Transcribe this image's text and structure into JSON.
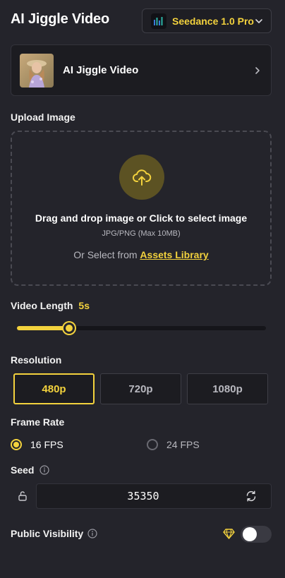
{
  "header": {
    "title": "AI Jiggle Video",
    "model": "Seedance 1.0 Pro"
  },
  "template": {
    "label": "AI Jiggle Video"
  },
  "upload": {
    "section_label": "Upload Image",
    "main_text": "Drag and drop image or Click to select image",
    "formats": "JPG/PNG (Max 10MB)",
    "or_text": "Or Select from",
    "assets_link": "Assets Library"
  },
  "video_length": {
    "label": "Video Length",
    "value": "5s",
    "fraction": 0.21
  },
  "resolution": {
    "label": "Resolution",
    "options": [
      "480p",
      "720p",
      "1080p"
    ],
    "selected": "480p"
  },
  "frame_rate": {
    "label": "Frame Rate",
    "options": [
      "16 FPS",
      "24 FPS"
    ],
    "selected": "16 FPS"
  },
  "seed": {
    "label": "Seed",
    "value": "35350"
  },
  "visibility": {
    "label": "Public Visibility",
    "enabled": false
  },
  "colors": {
    "accent": "#f3d23d",
    "background": "#24242b",
    "card": "#1c1c21"
  },
  "icons": {
    "model_logo": "bar-chart-logo-icon",
    "upload": "cloud-upload-icon",
    "seed_lock": "unlock-icon",
    "seed_refresh": "refresh-icon",
    "premium": "diamond-icon"
  }
}
